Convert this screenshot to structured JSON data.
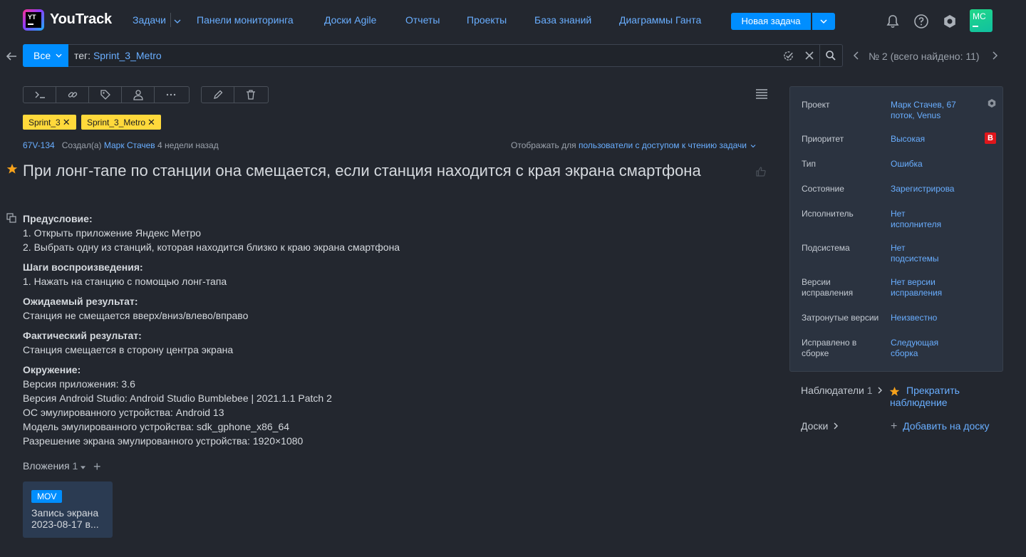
{
  "header": {
    "logo_text": "YT",
    "brand": "YouTrack",
    "nav": [
      "Задачи",
      "Панели мониторинга",
      "Доски Agile",
      "Отчеты",
      "Проекты",
      "База знаний",
      "Диаграммы Ганта"
    ],
    "new_task": "Новая задача",
    "avatar": "MC"
  },
  "search": {
    "scope": "Все",
    "query_prefix": "тег:",
    "query_value": "Sprint_3_Metro",
    "pager": "№ 2 (всего найдено: 11)"
  },
  "issue": {
    "tags": [
      "Sprint_3",
      "Sprint_3_Metro"
    ],
    "id": "67V-134",
    "created_by_prefix": "Создал(а)",
    "author": "Марк Стачев",
    "created_ago": "4 недели назад",
    "visibility_prefix": "Отображать для",
    "visibility_value": "пользователи с доступом к чтению задачи",
    "title": "При лонг-тапе по станции она смещается, если станция находится с края экрана смартфона",
    "description": {
      "precondition_h": "Предусловие:",
      "precondition_1": "1. Открыть приложение Яндекс Метро",
      "precondition_2": "2. Выбрать одну из станций, которая находится близко к краю экрана смартфона",
      "steps_h": "Шаги воспроизведения:",
      "steps_1": "1. Нажать на станцию с помощью лонг-тапа",
      "expected_h": "Ожидаемый результат:",
      "expected_1": "Станция не смещается вверх/вниз/влево/вправо",
      "actual_h": "Фактический результат:",
      "actual_1": "Станция смещается в сторону центра экрана",
      "env_h": "Окружение:",
      "env_1": "Версия приложения: 3.6",
      "env_2": "Версия Android Studio: Android Studio Bumblebee | 2021.1.1 Patch 2",
      "env_3": "ОС эмулированного устройства: Android 13",
      "env_4": "Модель эмулированного устройства: sdk_gphone_x86_64",
      "env_5": "Разрешение экрана эмулированного устройства: 1920×1080"
    },
    "attachments_label": "Вложения",
    "attachments_count": "1",
    "attachment": {
      "type": "MOV",
      "name": "Запись экрана 2023-08-17 в..."
    }
  },
  "fields": [
    {
      "key": "Проект",
      "value": "Марк Стачев, 67 поток, Venus"
    },
    {
      "key": "Приоритет",
      "value": "Высокая",
      "badge": "В"
    },
    {
      "key": "Тип",
      "value": "Ошибка"
    },
    {
      "key": "Состояние",
      "value": "Зарегистрирова"
    },
    {
      "key": "Исполнитель",
      "value": "Нет исполнителя"
    },
    {
      "key": "Подсистема",
      "value": "Нет подсистемы"
    },
    {
      "key": "Версии исправления",
      "value": "Нет версии исправления"
    },
    {
      "key": "Затронутые версии",
      "value": "Неизвестно"
    },
    {
      "key": "Исправлено в сборке",
      "value": "Следующая сборка"
    }
  ],
  "sidebar": {
    "watchers_label": "Наблюдатели",
    "watchers_count": "1",
    "stop_watching": "Прекратить наблюдение",
    "boards_label": "Доски",
    "add_to_board": "Добавить на доску"
  },
  "colors": {
    "background": "#23272f",
    "accent": "#008eff",
    "link": "#69aeff",
    "tag": "#ffd93b",
    "priority": "#e0161b",
    "star": "#f7a21b"
  }
}
